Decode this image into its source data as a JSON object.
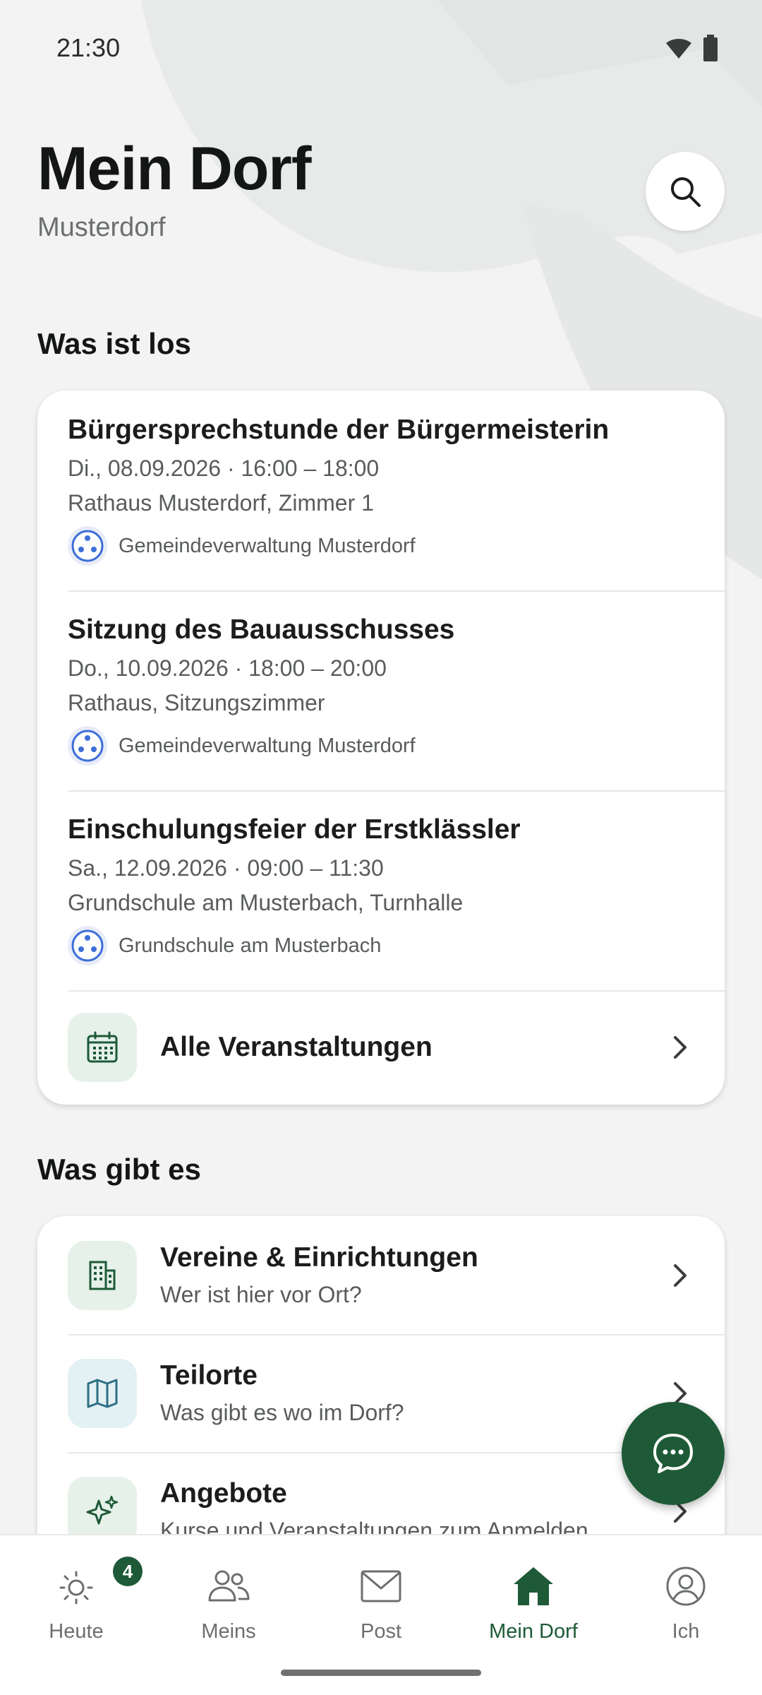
{
  "status_bar": {
    "time": "21:30"
  },
  "header": {
    "title": "Mein Dorf",
    "subtitle": "Musterdorf"
  },
  "sections": {
    "events_title": "Was ist los",
    "offers_title": "Was gibt es"
  },
  "events": [
    {
      "title": "Bürgersprechstunde der Bürgermeisterin",
      "date": "Di., 08.09.2026 · 16:00 – 18:00",
      "place": "Rathaus Musterdorf, Zimmer 1",
      "organizer": "Gemeindeverwaltung Musterdorf"
    },
    {
      "title": "Sitzung des Bauausschusses",
      "date": "Do., 10.09.2026 · 18:00 – 20:00",
      "place": "Rathaus, Sitzungszimmer",
      "organizer": "Gemeindeverwaltung Musterdorf"
    },
    {
      "title": "Einschulungsfeier der Erstklässler",
      "date": "Sa., 12.09.2026 · 09:00 – 11:30",
      "place": "Grundschule am Musterbach, Turnhalle",
      "organizer": "Grundschule am Musterbach"
    }
  ],
  "all_events_label": "Alle Veranstaltungen",
  "offers": [
    {
      "title": "Vereine & Einrichtungen",
      "subtitle": "Wer ist hier vor Ort?"
    },
    {
      "title": "Teilorte",
      "subtitle": "Was gibt es wo im Dorf?"
    },
    {
      "title": "Angebote",
      "subtitle": "Kurse und Veranstaltungen zum Anmelden"
    }
  ],
  "bottom_nav": [
    {
      "label": "Heute",
      "badge": "4"
    },
    {
      "label": "Meins"
    },
    {
      "label": "Post"
    },
    {
      "label": "Mein Dorf"
    },
    {
      "label": "Ich"
    }
  ],
  "colors": {
    "accent": "#1e5a37",
    "background": "#f2f3f2",
    "org_icon": "#3e6fd8"
  }
}
